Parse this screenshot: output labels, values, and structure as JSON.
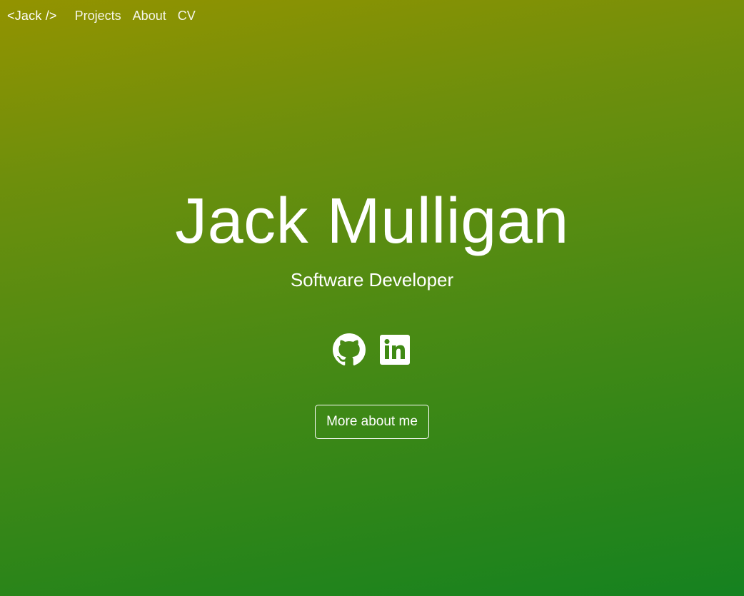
{
  "navbar": {
    "brand": "<Jack />",
    "links": [
      {
        "label": "Projects"
      },
      {
        "label": "About"
      },
      {
        "label": "CV"
      }
    ]
  },
  "hero": {
    "name": "Jack Mulligan",
    "role": "Software Developer",
    "socials": [
      {
        "icon": "github-icon"
      },
      {
        "icon": "linkedin-icon"
      }
    ],
    "cta_label": "More about me"
  },
  "colors": {
    "gradient_top": "#939300",
    "gradient_bottom": "#158220",
    "text": "#ffffff"
  }
}
